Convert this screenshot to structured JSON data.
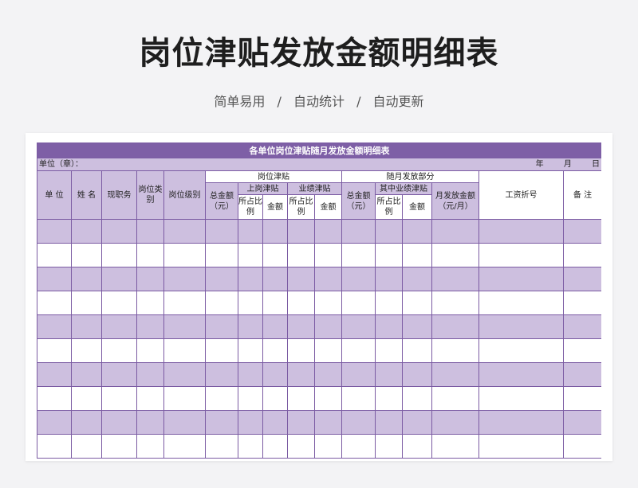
{
  "page": {
    "title": "岗位津贴发放金额明细表",
    "subtitle": "简单易用 / 自动统计 / 自动更新"
  },
  "sheet": {
    "banner": "各单位岗位津贴随月发放金额明细表",
    "unit_label": "单位（章）：",
    "date_label": "年 月 日",
    "headers": {
      "unit": "单 位",
      "name": "姓 名",
      "current_post": "现职务",
      "post_category": "岗位类别",
      "post_level": "岗位级别",
      "post_allowance": "岗位津贴",
      "total_amount": "总金额（元）",
      "on_duty_allowance": "上岗津贴",
      "performance_allowance": "业绩津贴",
      "ratio": "所占比例",
      "amount": "金额",
      "monthly_part": "随月发放部分",
      "monthly_total": "总金额（元）",
      "middle_performance": "其中业绩津贴",
      "monthly_issued": "月发放金额（元/月）",
      "bankbook": "工资折号",
      "remarks": "备 注"
    },
    "colors": {
      "header_purple": "#7e5fa6",
      "row_purple": "#cdbfdf",
      "border": "#7b5ba3"
    }
  }
}
